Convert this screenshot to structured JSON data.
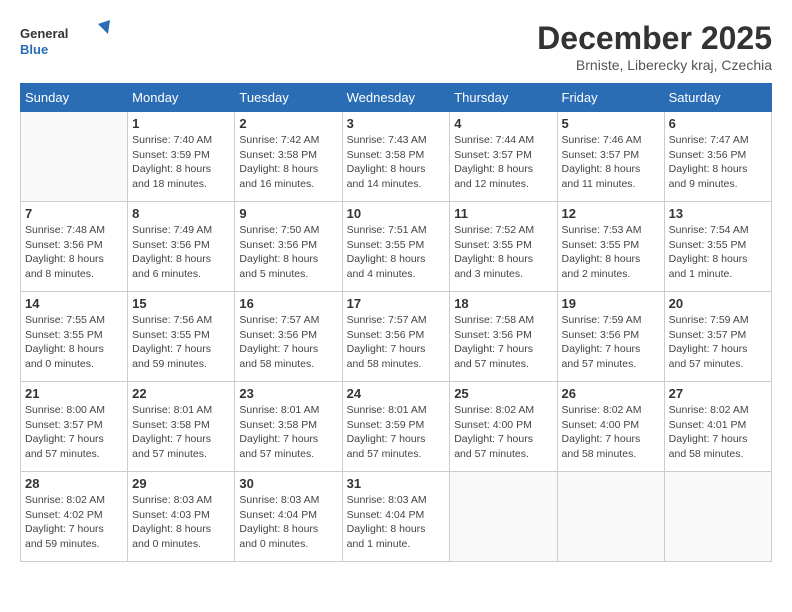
{
  "logo": {
    "text_general": "General",
    "text_blue": "Blue"
  },
  "header": {
    "month_title": "December 2025",
    "subtitle": "Brniste, Liberecky kraj, Czechia"
  },
  "days_of_week": [
    "Sunday",
    "Monday",
    "Tuesday",
    "Wednesday",
    "Thursday",
    "Friday",
    "Saturday"
  ],
  "weeks": [
    [
      {
        "day": "",
        "info": ""
      },
      {
        "day": "1",
        "info": "Sunrise: 7:40 AM\nSunset: 3:59 PM\nDaylight: 8 hours\nand 18 minutes."
      },
      {
        "day": "2",
        "info": "Sunrise: 7:42 AM\nSunset: 3:58 PM\nDaylight: 8 hours\nand 16 minutes."
      },
      {
        "day": "3",
        "info": "Sunrise: 7:43 AM\nSunset: 3:58 PM\nDaylight: 8 hours\nand 14 minutes."
      },
      {
        "day": "4",
        "info": "Sunrise: 7:44 AM\nSunset: 3:57 PM\nDaylight: 8 hours\nand 12 minutes."
      },
      {
        "day": "5",
        "info": "Sunrise: 7:46 AM\nSunset: 3:57 PM\nDaylight: 8 hours\nand 11 minutes."
      },
      {
        "day": "6",
        "info": "Sunrise: 7:47 AM\nSunset: 3:56 PM\nDaylight: 8 hours\nand 9 minutes."
      }
    ],
    [
      {
        "day": "7",
        "info": "Sunrise: 7:48 AM\nSunset: 3:56 PM\nDaylight: 8 hours\nand 8 minutes."
      },
      {
        "day": "8",
        "info": "Sunrise: 7:49 AM\nSunset: 3:56 PM\nDaylight: 8 hours\nand 6 minutes."
      },
      {
        "day": "9",
        "info": "Sunrise: 7:50 AM\nSunset: 3:56 PM\nDaylight: 8 hours\nand 5 minutes."
      },
      {
        "day": "10",
        "info": "Sunrise: 7:51 AM\nSunset: 3:55 PM\nDaylight: 8 hours\nand 4 minutes."
      },
      {
        "day": "11",
        "info": "Sunrise: 7:52 AM\nSunset: 3:55 PM\nDaylight: 8 hours\nand 3 minutes."
      },
      {
        "day": "12",
        "info": "Sunrise: 7:53 AM\nSunset: 3:55 PM\nDaylight: 8 hours\nand 2 minutes."
      },
      {
        "day": "13",
        "info": "Sunrise: 7:54 AM\nSunset: 3:55 PM\nDaylight: 8 hours\nand 1 minute."
      }
    ],
    [
      {
        "day": "14",
        "info": "Sunrise: 7:55 AM\nSunset: 3:55 PM\nDaylight: 8 hours\nand 0 minutes."
      },
      {
        "day": "15",
        "info": "Sunrise: 7:56 AM\nSunset: 3:55 PM\nDaylight: 7 hours\nand 59 minutes."
      },
      {
        "day": "16",
        "info": "Sunrise: 7:57 AM\nSunset: 3:56 PM\nDaylight: 7 hours\nand 58 minutes."
      },
      {
        "day": "17",
        "info": "Sunrise: 7:57 AM\nSunset: 3:56 PM\nDaylight: 7 hours\nand 58 minutes."
      },
      {
        "day": "18",
        "info": "Sunrise: 7:58 AM\nSunset: 3:56 PM\nDaylight: 7 hours\nand 57 minutes."
      },
      {
        "day": "19",
        "info": "Sunrise: 7:59 AM\nSunset: 3:56 PM\nDaylight: 7 hours\nand 57 minutes."
      },
      {
        "day": "20",
        "info": "Sunrise: 7:59 AM\nSunset: 3:57 PM\nDaylight: 7 hours\nand 57 minutes."
      }
    ],
    [
      {
        "day": "21",
        "info": "Sunrise: 8:00 AM\nSunset: 3:57 PM\nDaylight: 7 hours\nand 57 minutes."
      },
      {
        "day": "22",
        "info": "Sunrise: 8:01 AM\nSunset: 3:58 PM\nDaylight: 7 hours\nand 57 minutes."
      },
      {
        "day": "23",
        "info": "Sunrise: 8:01 AM\nSunset: 3:58 PM\nDaylight: 7 hours\nand 57 minutes."
      },
      {
        "day": "24",
        "info": "Sunrise: 8:01 AM\nSunset: 3:59 PM\nDaylight: 7 hours\nand 57 minutes."
      },
      {
        "day": "25",
        "info": "Sunrise: 8:02 AM\nSunset: 4:00 PM\nDaylight: 7 hours\nand 57 minutes."
      },
      {
        "day": "26",
        "info": "Sunrise: 8:02 AM\nSunset: 4:00 PM\nDaylight: 7 hours\nand 58 minutes."
      },
      {
        "day": "27",
        "info": "Sunrise: 8:02 AM\nSunset: 4:01 PM\nDaylight: 7 hours\nand 58 minutes."
      }
    ],
    [
      {
        "day": "28",
        "info": "Sunrise: 8:02 AM\nSunset: 4:02 PM\nDaylight: 7 hours\nand 59 minutes."
      },
      {
        "day": "29",
        "info": "Sunrise: 8:03 AM\nSunset: 4:03 PM\nDaylight: 8 hours\nand 0 minutes."
      },
      {
        "day": "30",
        "info": "Sunrise: 8:03 AM\nSunset: 4:04 PM\nDaylight: 8 hours\nand 0 minutes."
      },
      {
        "day": "31",
        "info": "Sunrise: 8:03 AM\nSunset: 4:04 PM\nDaylight: 8 hours\nand 1 minute."
      },
      {
        "day": "",
        "info": ""
      },
      {
        "day": "",
        "info": ""
      },
      {
        "day": "",
        "info": ""
      }
    ]
  ]
}
